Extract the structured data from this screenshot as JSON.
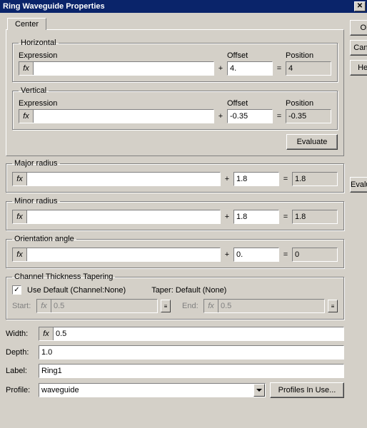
{
  "window": {
    "title": "Ring Waveguide Properties"
  },
  "buttons": {
    "ok": "OK",
    "cancel": "Cancel",
    "help": "Help",
    "evaluate": "Evaluate",
    "profiles_in_use": "Profiles In Use..."
  },
  "tabs": {
    "center": "Center"
  },
  "center": {
    "horizontal": {
      "legend": "Horizontal",
      "labels": {
        "expression": "Expression",
        "offset": "Offset",
        "position": "Position"
      },
      "expression": "",
      "offset": "4.",
      "position": "4"
    },
    "vertical": {
      "legend": "Vertical",
      "labels": {
        "expression": "Expression",
        "offset": "Offset",
        "position": "Position"
      },
      "expression": "",
      "offset": "-0.35",
      "position": "-0.35"
    }
  },
  "major_radius": {
    "legend": "Major radius",
    "expression": "",
    "offset": "1.8",
    "result": "1.8"
  },
  "minor_radius": {
    "legend": "Minor radius",
    "expression": "",
    "offset": "1.8",
    "result": "1.8"
  },
  "orientation_angle": {
    "legend": "Orientation angle",
    "expression": "",
    "offset": "0.",
    "result": "0"
  },
  "tapering": {
    "legend": "Channel Thickness Tapering",
    "use_default_label": "Use Default (Channel:None)",
    "use_default_checked": true,
    "taper_label": "Taper:  Default (None)",
    "start_label": "Start:",
    "end_label": "End:",
    "start": "0.5",
    "end": "0.5"
  },
  "bottom": {
    "width_label": "Width:",
    "width": "0.5",
    "depth_label": "Depth:",
    "depth": "1.0",
    "label_label": "Label:",
    "label": "Ring1",
    "profile_label": "Profile:",
    "profile": "waveguide"
  },
  "glyphs": {
    "fx": "fx",
    "plus": "+",
    "eq": "=",
    "check": "✓"
  }
}
